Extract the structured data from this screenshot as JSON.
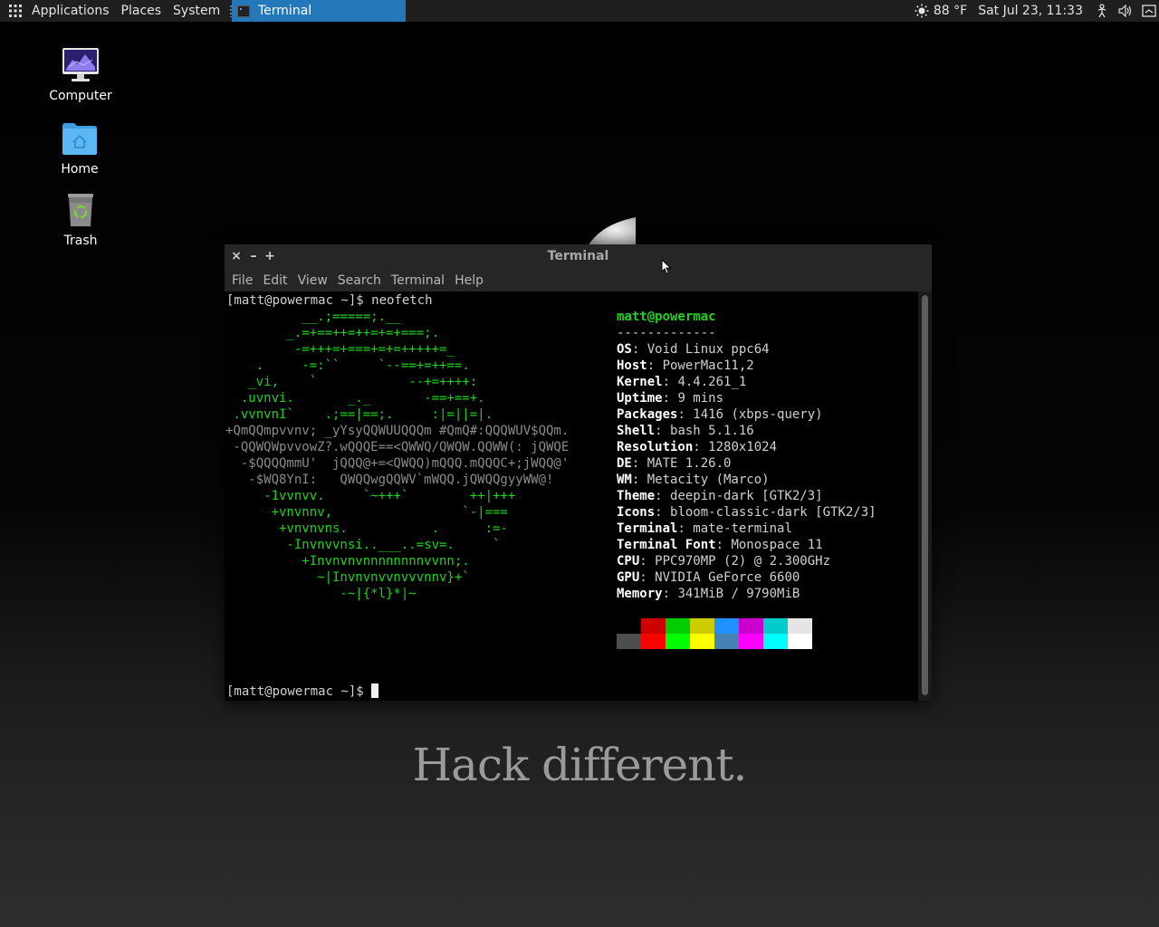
{
  "panel": {
    "menus": [
      "Applications",
      "Places",
      "System"
    ],
    "task": "Terminal",
    "weather": "88 °F",
    "clock": "Sat Jul 23, 11:33",
    "icons": [
      "apps-grid-icon",
      "weather-sun-icon",
      "accessibility-icon",
      "volume-icon",
      "power-icon"
    ]
  },
  "desktop": {
    "icons": [
      {
        "label": "Computer",
        "icon": "computer-icon"
      },
      {
        "label": "Home",
        "icon": "home-folder-icon"
      },
      {
        "label": "Trash",
        "icon": "trash-icon"
      }
    ],
    "tagline": "Hack different."
  },
  "window": {
    "title": "Terminal",
    "menu": [
      "File",
      "Edit",
      "View",
      "Search",
      "Terminal",
      "Help"
    ]
  },
  "terminal": {
    "prompt": "[matt@powermac ~]$",
    "command": "neofetch",
    "ascii": [
      "          __.;=====;.__",
      "        _.=+==++=++=+=+===;.",
      "         -=+++=+===+=+=+++++=_",
      "    .     -=:``     `--==+=++==.",
      "   _vi,    `            --+=++++:",
      "  .uvnvi.       _._       -==+==+.",
      " .vvnvnI`    .;==|==;.     :|=||=|.",
      "+QmQQmpvvnv; _yYsyQQWUUQQQm #QmQ#:QQQWUV$QQm.",
      " -QQWQWpvvowZ?.wQQQE==<QWWQ/QWQW.QQWW(: jQWQE",
      "  -$QQQQmmU'  jQQQ@+=<QWQQ)mQQQ.mQQQC+;jWQQ@'",
      "   -$WQ8YnI:   QWQQwgQQWV`mWQQ.jQWQQgyyWW@!",
      "     -1vvnvv.     `~+++`        ++|+++",
      "      +vnvnnv,                 `-|===",
      "       +vnvnvns.           .      :=-",
      "        -Invnvvnsi..___..=sv=.     `",
      "          +Invnvnvnnnnnnnnvvnn;.",
      "            ~|Invnvnvvnvvvnnv}+`",
      "               -~|{*l}*|~"
    ],
    "user_host": "matt@powermac",
    "underline": "-------------",
    "info": [
      {
        "key": "OS",
        "value": "Void Linux ppc64"
      },
      {
        "key": "Host",
        "value": "PowerMac11,2"
      },
      {
        "key": "Kernel",
        "value": "4.4.261_1"
      },
      {
        "key": "Uptime",
        "value": "9 mins"
      },
      {
        "key": "Packages",
        "value": "1416 (xbps-query)"
      },
      {
        "key": "Shell",
        "value": "bash 5.1.16"
      },
      {
        "key": "Resolution",
        "value": "1280x1024"
      },
      {
        "key": "DE",
        "value": "MATE 1.26.0"
      },
      {
        "key": "WM",
        "value": "Metacity (Marco)"
      },
      {
        "key": "Theme",
        "value": "deepin-dark [GTK2/3]"
      },
      {
        "key": "Icons",
        "value": "bloom-classic-dark [GTK2/3]"
      },
      {
        "key": "Terminal",
        "value": "mate-terminal"
      },
      {
        "key": "Terminal Font",
        "value": "Monospace 11"
      },
      {
        "key": "CPU",
        "value": "PPC970MP (2) @ 2.300GHz"
      },
      {
        "key": "GPU",
        "value": "NVIDIA GeForce 6600"
      },
      {
        "key": "Memory",
        "value": "341MiB / 9790MiB"
      }
    ],
    "palette_top": [
      "#000000",
      "#cc0000",
      "#00cc00",
      "#cccc00",
      "#1e90ff",
      "#cc00cc",
      "#00cccc",
      "#e5e5e5"
    ],
    "palette_bottom": [
      "#4d4d4d",
      "#ff0000",
      "#00ff00",
      "#ffff00",
      "#4682b4",
      "#ff00ff",
      "#00ffff",
      "#ffffff"
    ]
  }
}
